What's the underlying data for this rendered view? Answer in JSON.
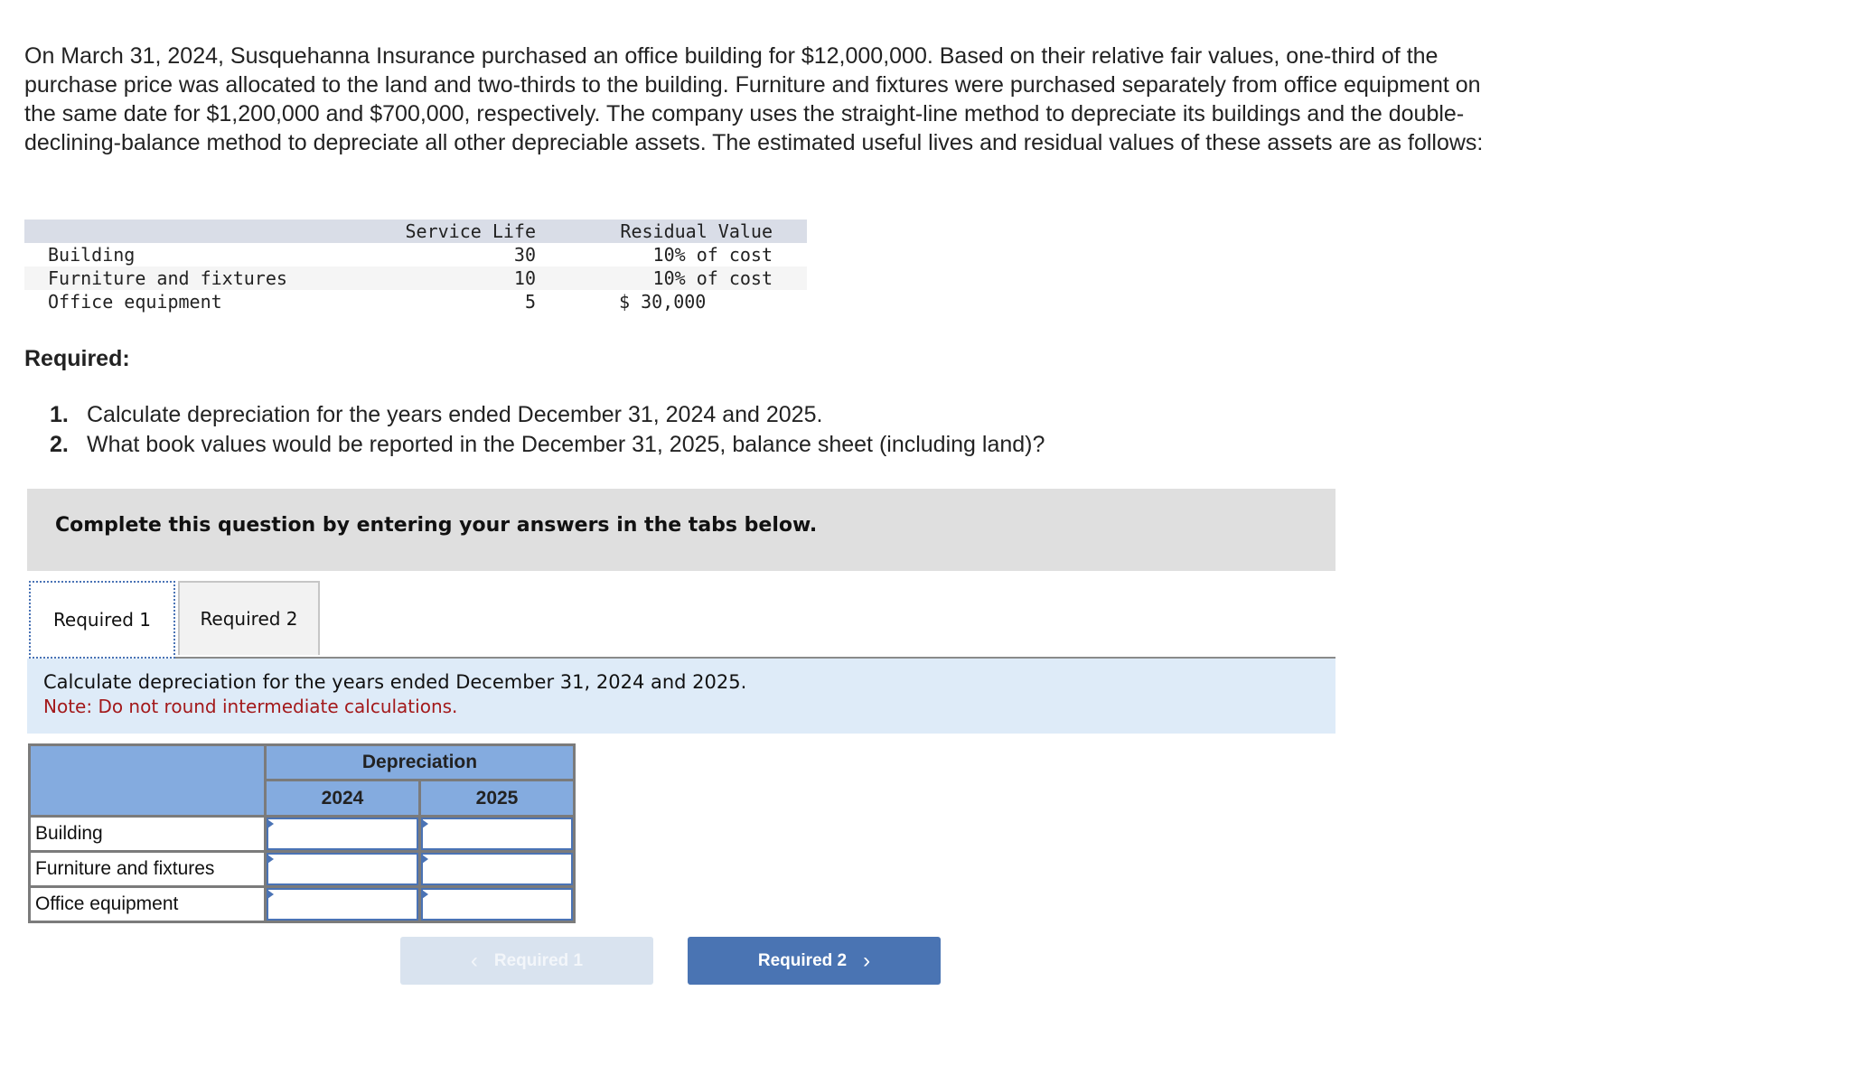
{
  "intro": {
    "text": "On March 31, 2024, Susquehanna Insurance purchased an office building for $12,000,000. Based on their relative fair values, one-third of the purchase price was allocated to the land and two-thirds to the building. Furniture and fixtures were purchased separately from office equipment on the same date for $1,200,000 and $700,000, respectively. The company uses the straight-line method to depreciate its buildings and the double-declining-balance method to depreciate all other depreciable assets. The estimated useful lives and residual values of these assets are as follows:"
  },
  "asset_table": {
    "headers": [
      "",
      "Service Life",
      "Residual Value"
    ],
    "rows": [
      {
        "asset": "Building",
        "life": "30",
        "residual": "10% of cost"
      },
      {
        "asset": "Furniture and fixtures",
        "life": "10",
        "residual": "10% of cost"
      },
      {
        "asset": "Office equipment",
        "life": "5",
        "residual": "$ 30,000"
      }
    ]
  },
  "required": {
    "heading": "Required:",
    "items": [
      {
        "num": "1.",
        "text": "Calculate depreciation for the years ended December 31, 2024 and 2025."
      },
      {
        "num": "2.",
        "text": "What book values would be reported in the December 31, 2025, balance sheet (including land)?"
      }
    ]
  },
  "instruction": "Complete this question by entering your answers in the tabs below.",
  "tabs": [
    {
      "label": "Required 1",
      "active": true
    },
    {
      "label": "Required 2",
      "active": false
    }
  ],
  "panel": {
    "prompt": "Calculate depreciation for the years ended December 31, 2024 and 2025.",
    "note": "Note: Do not round intermediate calculations."
  },
  "answer_table": {
    "group_header": "Depreciation",
    "years": [
      "2024",
      "2025"
    ],
    "rows": [
      {
        "label": "Building",
        "values": [
          "",
          ""
        ]
      },
      {
        "label": "Furniture and fixtures",
        "values": [
          "",
          ""
        ]
      },
      {
        "label": "Office equipment",
        "values": [
          "",
          ""
        ]
      }
    ]
  },
  "nav": {
    "prev_label": "Required 1",
    "next_label": "Required 2",
    "prev_icon": "‹",
    "next_icon": "›"
  }
}
